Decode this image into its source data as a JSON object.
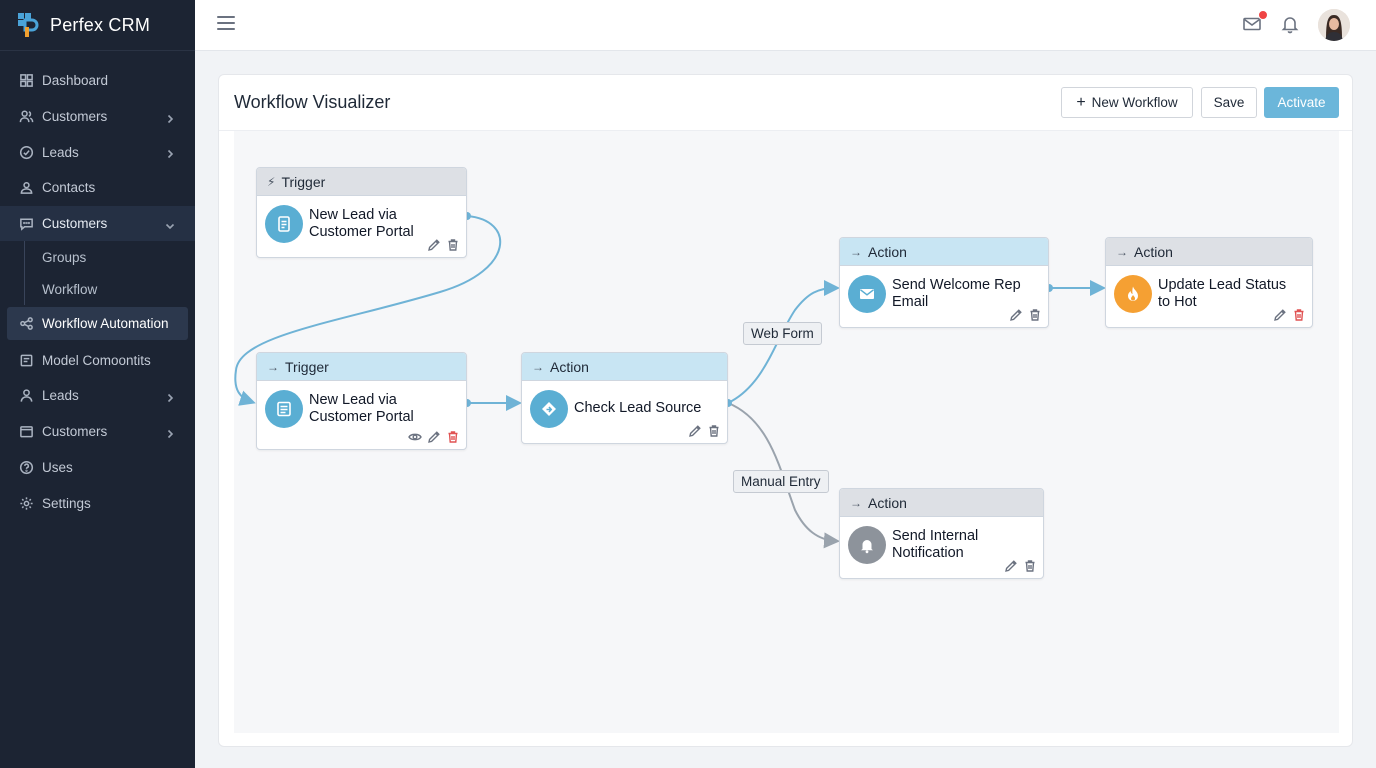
{
  "app": {
    "name": "Perfex CRM"
  },
  "sidebar": {
    "items": [
      {
        "label": "Dashboard",
        "icon": "dashboard-icon",
        "chevron": false
      },
      {
        "label": "Customers",
        "icon": "users-icon",
        "chevron": true
      },
      {
        "label": "Leads",
        "icon": "check-circle-icon",
        "chevron": true
      },
      {
        "label": "Contacts",
        "icon": "contacts-icon",
        "chevron": false
      },
      {
        "label": "Customers",
        "icon": "chat-icon",
        "chevron": "down"
      }
    ],
    "subitems": [
      {
        "label": "Groups"
      },
      {
        "label": "Workflow"
      }
    ],
    "active": {
      "label": "Workflow Automation",
      "icon": "share-nodes-icon"
    },
    "items_after": [
      {
        "label": "Model Comoontits",
        "icon": "box-icon",
        "chevron": false
      },
      {
        "label": "Leads",
        "icon": "user-icon",
        "chevron": true
      },
      {
        "label": "Customers",
        "icon": "folder-icon",
        "chevron": true
      },
      {
        "label": "Uses",
        "icon": "help-icon",
        "chevron": false
      },
      {
        "label": "Settings",
        "icon": "gear-icon",
        "chevron": false
      }
    ]
  },
  "topbar": {
    "icons": [
      "menu-icon",
      "mail-icon",
      "bell-icon",
      "avatar"
    ]
  },
  "card": {
    "title": "Workflow Visualizer",
    "buttons": {
      "new_workflow": "New Workflow",
      "save": "Save",
      "activate": "Activate"
    }
  },
  "nodes": {
    "trigger1": {
      "type": "Trigger",
      "text1": "New Lead via",
      "text2": "Customer Portal"
    },
    "trigger2": {
      "type": "Trigger",
      "text1": "New Lead via",
      "text2": "Customer Portal"
    },
    "check": {
      "type": "Action",
      "text1": "Check Lead Source"
    },
    "welcome": {
      "type": "Action",
      "text1": "Send Welcome Rep",
      "text2": "Email"
    },
    "hot": {
      "type": "Action",
      "text1": "Update Lead Status",
      "text2": "to Hot"
    },
    "notify": {
      "type": "Action",
      "text1": "Send Internal",
      "text2": "Notification"
    }
  },
  "edges": {
    "web_form": "Web Form",
    "manual_entry": "Manual Entry"
  },
  "colors": {
    "sidebar_bg": "#1c2433",
    "accent_blue": "#6bb6da",
    "edge_blue": "#6fb3d6",
    "edge_gray": "#9aa3ad",
    "delete_red": "#e05252",
    "hot_orange": "#f5a033"
  }
}
